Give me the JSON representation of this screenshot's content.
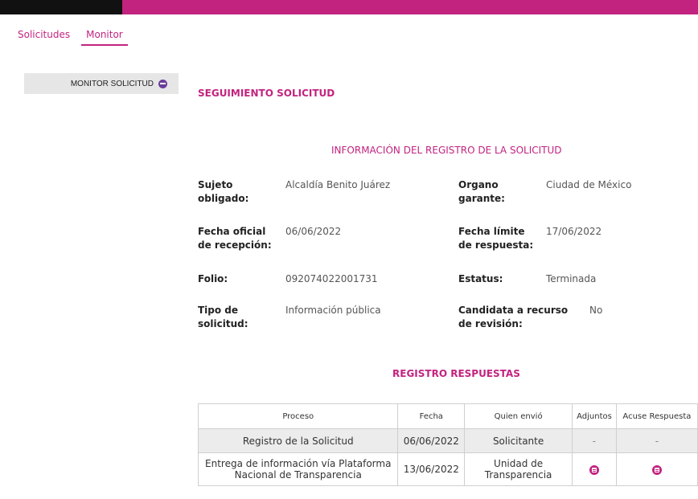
{
  "nav": {
    "tabs": [
      {
        "label": "Solicitudes"
      },
      {
        "label": "Monitor"
      }
    ]
  },
  "sidebar": {
    "button_label": "MONITOR SOLICITUD",
    "icon": "monitor-icon"
  },
  "page": {
    "title": "SEGUIMIENTO SOLICITUD",
    "info_title": "INFORMACIÓN DEL REGISTRO DE LA SOLICITUD",
    "responses_title": "REGISTRO RESPUESTAS"
  },
  "fields": {
    "sujeto_label_1": "Sujeto",
    "sujeto_label_2": "obligado:",
    "sujeto_value": "Alcaldía Benito Juárez",
    "organo_label_1": "Organo",
    "organo_label_2": "garante:",
    "organo_value": "Ciudad de México",
    "fecha_oficial_label_1": "Fecha oficial",
    "fecha_oficial_label_2": "de recepción:",
    "fecha_oficial_value": "06/06/2022",
    "fecha_limite_label_1": "Fecha límite",
    "fecha_limite_label_2": "de respuesta:",
    "fecha_limite_value": "17/06/2022",
    "folio_label": "Folio:",
    "folio_value": "092074022001731",
    "estatus_label": "Estatus:",
    "estatus_value": "Terminada",
    "tipo_label_1": "Tipo de",
    "tipo_label_2": "solicitud:",
    "tipo_value": "Información pública",
    "candidata_label_1": "Candidata a recurso",
    "candidata_label_2": "de revisión:",
    "candidata_value": "No"
  },
  "table": {
    "headers": [
      "Proceso",
      "Fecha",
      "Quien envió",
      "Adjuntos",
      "Acuse Respuesta"
    ],
    "rows": [
      {
        "proceso": "Registro de la Solicitud",
        "fecha": "06/06/2022",
        "quien": "Solicitante",
        "adjuntos": "-",
        "acuse": "-"
      },
      {
        "proceso_1": "Entrega de información vía Plataforma",
        "proceso_2": "Nacional de Transparencia",
        "fecha": "13/06/2022",
        "quien_1": "Unidad de",
        "quien_2": "Transparencia",
        "adjuntos_icon": "document-icon",
        "acuse_icon": "document-icon"
      }
    ]
  },
  "colors": {
    "accent": "#c2237f",
    "dark_bar": "#111111",
    "sidebar_bg": "#e6e6e6"
  }
}
